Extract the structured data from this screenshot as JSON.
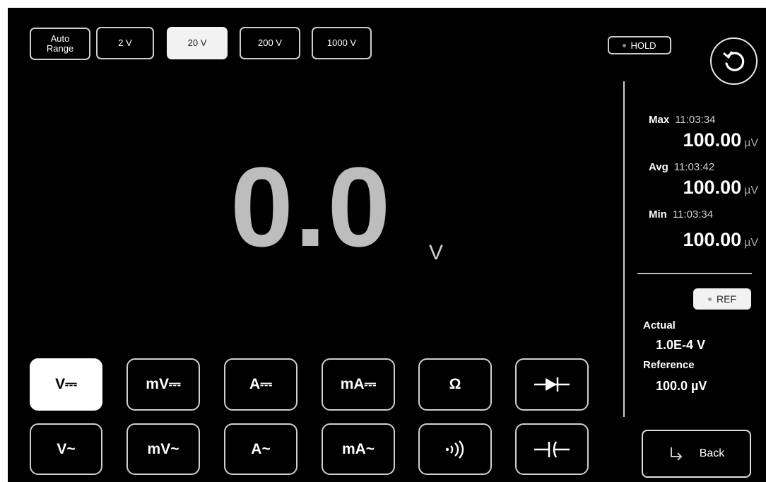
{
  "range": {
    "buttons": [
      {
        "label": "Auto\nRange",
        "selected": false
      },
      {
        "label": "2 V",
        "selected": false
      },
      {
        "label": "20 V",
        "selected": true
      },
      {
        "label": "200 V",
        "selected": false
      },
      {
        "label": "1000 V",
        "selected": false
      }
    ]
  },
  "hold": {
    "label": "HOLD"
  },
  "reset": {
    "icon": "reset-icon"
  },
  "display": {
    "value": "0.0",
    "unit": "V"
  },
  "stats": {
    "max": {
      "label": "Max",
      "time": "11:03:34",
      "value": "100.00",
      "unit": "µV"
    },
    "avg": {
      "label": "Avg",
      "time": "11:03:42",
      "value": "100.00",
      "unit": "µV"
    },
    "min": {
      "label": "Min",
      "time": "11:03:34",
      "value": "100.00",
      "unit": "µV"
    }
  },
  "ref": {
    "label": "REF",
    "actual_label": "Actual",
    "actual_value": "1.0E-4 V",
    "reference_label": "Reference",
    "reference_value": "100.0 µV"
  },
  "modes": {
    "row1": [
      "V⎓",
      "mV⎓",
      "A⎓",
      "mA⎓",
      "Ω",
      "diode"
    ],
    "row2": [
      "V~",
      "mV~",
      "A~",
      "mA~",
      "continuity",
      "capacitor"
    ],
    "selected": "V⎓",
    "v_dc": "V⎓",
    "mv_dc": "mV⎓",
    "a_dc": "A⎓",
    "ma_dc": "mA⎓",
    "ohm": "Ω",
    "v_ac": "V~",
    "mv_ac": "mV~",
    "a_ac": "A~",
    "ma_ac": "mA~"
  },
  "back": {
    "label": "Back"
  }
}
